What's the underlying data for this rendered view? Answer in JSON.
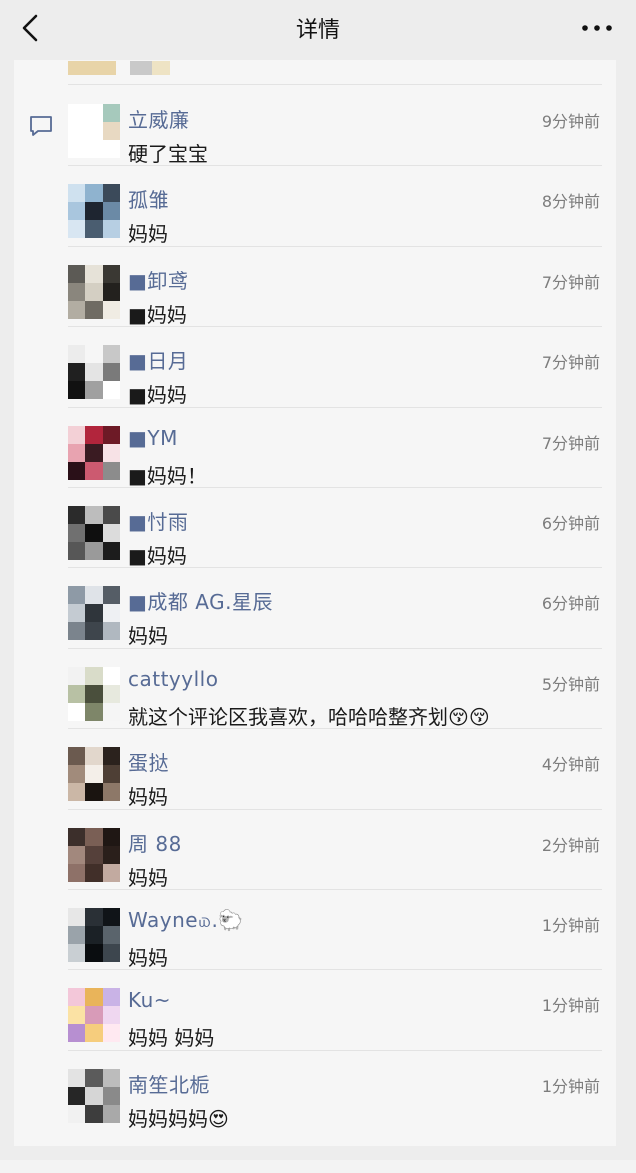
{
  "header": {
    "title": "详情"
  },
  "comments": [
    {
      "name": "立威廉",
      "time": "9分钟前",
      "text": "硬了宝宝"
    },
    {
      "name": "孤雏",
      "time": "8分钟前",
      "text": "妈妈"
    },
    {
      "name": "■卸鸢",
      "time": "7分钟前",
      "text": "■妈妈"
    },
    {
      "name": "■日月",
      "time": "7分钟前",
      "text": "■妈妈"
    },
    {
      "name": "■YM",
      "time": "7分钟前",
      "text": "■妈妈！"
    },
    {
      "name": "■忖雨",
      "time": "6分钟前",
      "text": "■妈妈"
    },
    {
      "name": "■成都 AG.星辰",
      "time": "6分钟前",
      "text": "妈妈"
    },
    {
      "name": "cattyyllo",
      "time": "5分钟前",
      "text": "就这个评论区我喜欢，哈哈哈整齐划😚😚"
    },
    {
      "name": "蛋挞",
      "time": "4分钟前",
      "text": "妈妈"
    },
    {
      "name": "周 88",
      "time": "2分钟前",
      "text": "妈妈"
    },
    {
      "name": "Wayne௰.🐑",
      "time": "1分钟前",
      "text": "妈妈"
    },
    {
      "name": "Ku~",
      "time": "1分钟前",
      "text": "妈妈 妈妈"
    },
    {
      "name": "南笙北栀",
      "time": "1分钟前",
      "text": "妈妈妈妈😍"
    }
  ],
  "icons": {
    "back": "chevron-left-icon",
    "more": "more-dots-icon",
    "comment": "comment-bubble-icon"
  },
  "colors": {
    "name": "#576b95",
    "time": "#7d7d7d",
    "background": "#ededed",
    "card": "#f6f6f6"
  }
}
